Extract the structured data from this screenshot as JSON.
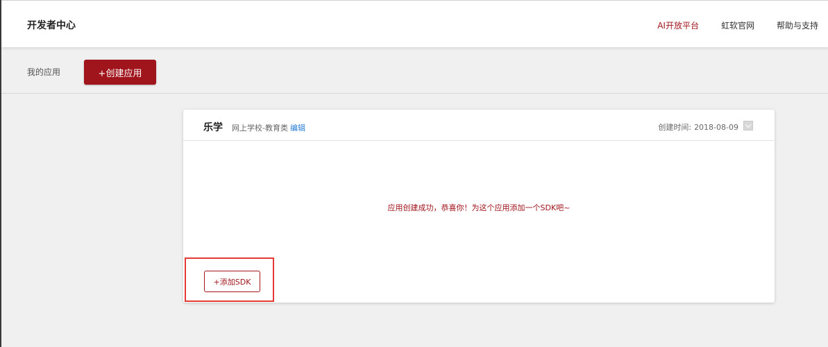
{
  "header": {
    "brand": "开发者中心",
    "nav": [
      {
        "label": "AI开放平台",
        "active": true
      },
      {
        "label": "虹软官网",
        "active": false
      },
      {
        "label": "帮助与支持",
        "active": false
      }
    ]
  },
  "subbar": {
    "my_apps": "我的应用",
    "create_button": "+创建应用"
  },
  "app_card": {
    "name": "乐学",
    "category": "网上学校-教育类",
    "edit_label": "编辑",
    "created_label": "创建时间:",
    "created_date": "2018-08-09",
    "success_message": "应用创建成功，恭喜你！为这个应用添加一个SDK吧~",
    "add_sdk_button": "+添加SDK"
  },
  "colors": {
    "brand_red": "#a0141c",
    "link_blue": "#2b7fd6",
    "highlight_red": "#e53935"
  }
}
